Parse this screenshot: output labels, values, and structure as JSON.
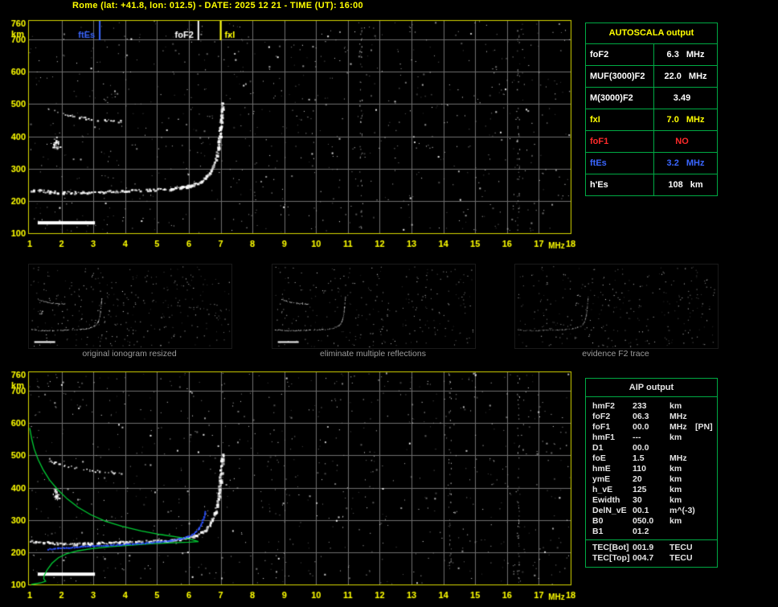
{
  "title": "Rome (lat: +41.8, lon: 012.5) - DATE: 2025 12 21 - TIME (UT): 16:00",
  "colors": {
    "accent_yellow": "#ffff00",
    "table_border_green": "#00aa44",
    "grid_gray": "#6f6f6f",
    "marker_blue": "#3a66ff",
    "status_red": "#ff2a2a",
    "caption_gray": "#9c9c9c",
    "profile_green": "#00cc33",
    "restored_blue": "#2b50ff"
  },
  "autoscala": {
    "header": "AUTOSCALA output",
    "rows": [
      {
        "label": "foF2",
        "value": "6.3",
        "unit": "MHz",
        "color": "#ffffff"
      },
      {
        "label": "MUF(3000)F2",
        "value": "22.0",
        "unit": "MHz",
        "color": "#ffffff"
      },
      {
        "label": "M(3000)F2",
        "value": "3.49",
        "unit": "",
        "color": "#ffffff"
      },
      {
        "label": "fxI",
        "value": "7.0",
        "unit": "MHz",
        "color": "#ffff00"
      },
      {
        "label": "foF1",
        "value": "NO",
        "unit": "",
        "color": "#ff2a2a"
      },
      {
        "label": "ftEs",
        "value": "3.2",
        "unit": "MHz",
        "color": "#3a66ff"
      },
      {
        "label": "h'Es",
        "value": "108",
        "unit": "km",
        "color": "#ffffff"
      }
    ]
  },
  "thumbnails": [
    {
      "caption": "original ionogram resized",
      "noise_dots": 330,
      "trace_indices": [
        0,
        1,
        2,
        3,
        4
      ],
      "brightness": 1
    },
    {
      "caption": "eliminate multiple reflections",
      "noise_dots": 270,
      "trace_indices": [
        0,
        1,
        2,
        4
      ],
      "brightness": 0.95
    },
    {
      "caption": "evidence F2 trace",
      "noise_dots": 300,
      "trace_indices": [
        0,
        1
      ],
      "brightness": 0.7
    }
  ],
  "aip": {
    "header": "AIP output",
    "rows": [
      {
        "label": "hmF2",
        "value": "233",
        "unit": "km",
        "note": ""
      },
      {
        "label": "foF2",
        "value": "06.3",
        "unit": "MHz",
        "note": ""
      },
      {
        "label": "foF1",
        "value": "00.0",
        "unit": "MHz",
        "note": "[PN]"
      },
      {
        "label": "hmF1",
        "value": "---",
        "unit": "km",
        "note": ""
      },
      {
        "label": "D1",
        "value": "00.0",
        "unit": "",
        "note": ""
      },
      {
        "label": "foE",
        "value": "1.5",
        "unit": "MHz",
        "note": ""
      },
      {
        "label": "hmE",
        "value": "110",
        "unit": "km",
        "note": ""
      },
      {
        "label": "ymE",
        "value": "20",
        "unit": "km",
        "note": ""
      },
      {
        "label": "h_vE",
        "value": "125",
        "unit": "km",
        "note": ""
      },
      {
        "label": "Ewidth",
        "value": "30",
        "unit": "km",
        "note": ""
      },
      {
        "label": "DelN_vE",
        "value": "00.1",
        "unit": "m^(-3)",
        "note": ""
      },
      {
        "label": "B0",
        "value": "050.0",
        "unit": "km",
        "note": ""
      },
      {
        "label": "B1",
        "value": "01.2",
        "unit": "",
        "note": ""
      }
    ],
    "tec_rows": [
      {
        "label": "TEC[Bot]",
        "value": "001.9",
        "unit": "TECU"
      },
      {
        "label": "TEC[Top]",
        "value": "004.7",
        "unit": "TECU"
      }
    ]
  },
  "chart_data": [
    {
      "type": "scatter",
      "name": "ionogram with autoscala frequency markers",
      "xlabel": "MHz",
      "ylabel": "km",
      "xlim": [
        0.95,
        18.05
      ],
      "ylim": [
        100,
        762
      ],
      "xticks": [
        1,
        2,
        3,
        4,
        5,
        6,
        7,
        8,
        9,
        10,
        11,
        12,
        13,
        14,
        15,
        16,
        17,
        18
      ],
      "yticks": [
        100,
        200,
        300,
        400,
        500,
        600,
        700,
        760
      ],
      "grid": true,
      "seed": 11,
      "noise": {
        "dots": 820
      },
      "rfi_columns": [
        11.4,
        16.35
      ],
      "frequency_markers": [
        {
          "label": "ftEs",
          "x": 3.2,
          "color": "#3a66ff",
          "label_side": "left"
        },
        {
          "label": "foF2",
          "x": 6.3,
          "color": "#ffffff",
          "label_side": "left"
        },
        {
          "label": "fxI",
          "x": 7.0,
          "color": "#ffff00",
          "label_side": "right"
        }
      ],
      "traces": [
        {
          "name": "sporadic-E trace ~230 km",
          "style": "dash",
          "size": 2.5,
          "gap": 0.18,
          "points": [
            [
              1.0,
              236
            ],
            [
              1.3,
              233
            ],
            [
              1.6,
              230
            ],
            [
              2.0,
              228
            ],
            [
              2.4,
              227
            ],
            [
              2.8,
              228
            ],
            [
              3.2,
              230
            ],
            [
              3.6,
              231
            ],
            [
              4.0,
              233
            ],
            [
              4.4,
              234
            ],
            [
              4.8,
              236
            ],
            [
              5.1,
              237
            ],
            [
              5.4,
              239
            ]
          ]
        },
        {
          "name": "F2 trace rising to foF2",
          "style": "dash",
          "size": 3,
          "gap": 0.1,
          "points": [
            [
              5.4,
              239
            ],
            [
              5.7,
              243
            ],
            [
              5.95,
              248
            ],
            [
              6.15,
              254
            ],
            [
              6.35,
              262
            ],
            [
              6.5,
              272
            ],
            [
              6.62,
              285
            ],
            [
              6.72,
              302
            ],
            [
              6.8,
              324
            ],
            [
              6.87,
              352
            ],
            [
              6.92,
              385
            ],
            [
              6.96,
              420
            ],
            [
              6.99,
              455
            ],
            [
              7.02,
              487
            ],
            [
              7.04,
              505
            ]
          ]
        },
        {
          "name": "second order echo ~450-490 km",
          "style": "dash",
          "size": 2,
          "gap": 0.45,
          "points": [
            [
              1.55,
              487
            ],
            [
              1.75,
              480
            ],
            [
              1.95,
              474
            ],
            [
              2.15,
              468
            ],
            [
              2.35,
              463
            ],
            [
              2.6,
              459
            ],
            [
              2.85,
              455
            ],
            [
              3.1,
              452
            ],
            [
              3.35,
              450
            ],
            [
              3.6,
              449
            ],
            [
              3.85,
              448
            ]
          ]
        },
        {
          "name": "echo patch ~380 km",
          "style": "cluster",
          "center": [
            1.82,
            380
          ],
          "spread": [
            0.12,
            22
          ],
          "count": 32
        },
        {
          "name": "interference bar ~130 km",
          "style": "bar",
          "x_range": [
            1.25,
            3.05
          ],
          "km_range": [
            127,
            137
          ]
        }
      ]
    },
    {
      "type": "scatter",
      "name": "ionogram with AIP restored trace and electron density profile",
      "xlabel": "MHz",
      "ylabel": "km",
      "xlim": [
        0.95,
        18.05
      ],
      "ylim": [
        100,
        762
      ],
      "xticks": [
        1,
        2,
        3,
        4,
        5,
        6,
        7,
        8,
        9,
        10,
        11,
        12,
        13,
        14,
        15,
        16,
        17,
        18
      ],
      "yticks": [
        100,
        200,
        300,
        400,
        500,
        600,
        700,
        760
      ],
      "grid": true,
      "seed": 23,
      "noise": {
        "dots": 820
      },
      "rfi_columns": [
        14.2,
        16.35
      ],
      "traces": [
        {
          "name": "sporadic-E trace ~230 km",
          "style": "dash",
          "size": 2.5,
          "gap": 0.18,
          "points": [
            [
              1.0,
              236
            ],
            [
              1.3,
              233
            ],
            [
              1.6,
              230
            ],
            [
              2.0,
              228
            ],
            [
              2.4,
              227
            ],
            [
              2.8,
              228
            ],
            [
              3.2,
              230
            ],
            [
              3.6,
              231
            ],
            [
              4.0,
              233
            ],
            [
              4.4,
              234
            ],
            [
              4.8,
              236
            ],
            [
              5.1,
              237
            ],
            [
              5.4,
              239
            ]
          ]
        },
        {
          "name": "F2 trace rising to foF2",
          "style": "dash",
          "size": 3,
          "gap": 0.1,
          "points": [
            [
              5.4,
              239
            ],
            [
              5.7,
              243
            ],
            [
              5.95,
              248
            ],
            [
              6.15,
              254
            ],
            [
              6.35,
              262
            ],
            [
              6.5,
              272
            ],
            [
              6.62,
              285
            ],
            [
              6.72,
              302
            ],
            [
              6.8,
              324
            ],
            [
              6.87,
              352
            ],
            [
              6.92,
              385
            ],
            [
              6.96,
              420
            ],
            [
              6.99,
              455
            ],
            [
              7.02,
              487
            ],
            [
              7.04,
              505
            ]
          ]
        },
        {
          "name": "second order echo ~450-490 km",
          "style": "dash",
          "size": 2,
          "gap": 0.45,
          "points": [
            [
              1.55,
              487
            ],
            [
              1.75,
              480
            ],
            [
              1.95,
              474
            ],
            [
              2.15,
              468
            ],
            [
              2.35,
              463
            ],
            [
              2.6,
              459
            ],
            [
              2.85,
              455
            ],
            [
              3.1,
              452
            ],
            [
              3.35,
              450
            ],
            [
              3.6,
              449
            ],
            [
              3.85,
              448
            ]
          ]
        },
        {
          "name": "echo patch ~380 km",
          "style": "cluster",
          "center": [
            1.82,
            380
          ],
          "spread": [
            0.12,
            22
          ],
          "count": 32
        },
        {
          "name": "interference bar ~130 km",
          "style": "bar",
          "x_range": [
            1.25,
            3.05
          ],
          "km_range": [
            127,
            137
          ]
        },
        {
          "name": "electron density profile topside (hmF2 233 km, foF2 6.3 MHz)",
          "style": "line",
          "color": "#00cc33",
          "width": 1.3,
          "points": [
            [
              1.0,
              585
            ],
            [
              1.06,
              552
            ],
            [
              1.14,
              520
            ],
            [
              1.26,
              488
            ],
            [
              1.42,
              456
            ],
            [
              1.62,
              424
            ],
            [
              1.88,
              394
            ],
            [
              2.18,
              365
            ],
            [
              2.52,
              339
            ],
            [
              2.92,
              316
            ],
            [
              3.38,
              296
            ],
            [
              3.9,
              280
            ],
            [
              4.5,
              266
            ],
            [
              5.1,
              255
            ],
            [
              5.7,
              246
            ],
            [
              6.1,
              239
            ],
            [
              6.3,
              233
            ]
          ]
        },
        {
          "name": "electron density profile bottomside (foE 1.5 MHz at 110 km)",
          "style": "line",
          "color": "#00cc33",
          "width": 1.3,
          "points": [
            [
              1.05,
              100
            ],
            [
              1.35,
              105
            ],
            [
              1.5,
              110
            ],
            [
              1.44,
              118
            ],
            [
              1.45,
              127
            ],
            [
              1.55,
              146
            ],
            [
              1.7,
              166
            ],
            [
              1.9,
              183
            ],
            [
              2.15,
              195
            ],
            [
              2.5,
              204
            ],
            [
              2.95,
              211
            ],
            [
              3.5,
              217
            ],
            [
              4.1,
              221
            ],
            [
              4.8,
              226
            ],
            [
              5.5,
              229
            ],
            [
              6.0,
              231
            ],
            [
              6.3,
              233
            ]
          ]
        },
        {
          "name": "restored F2 trace (fit)",
          "style": "dotline",
          "color": "#2b50ff",
          "size": 2,
          "points": [
            [
              1.55,
              211
            ],
            [
              1.85,
              214
            ],
            [
              2.2,
              216
            ],
            [
              2.6,
              219
            ],
            [
              3.0,
              221
            ],
            [
              3.4,
              223
            ],
            [
              3.8,
              225
            ],
            [
              4.2,
              228
            ],
            [
              4.6,
              230
            ],
            [
              5.0,
              233
            ],
            [
              5.4,
              238
            ],
            [
              5.7,
              243
            ],
            [
              5.95,
              250
            ],
            [
              6.15,
              260
            ],
            [
              6.3,
              275
            ],
            [
              6.4,
              295
            ],
            [
              6.46,
              312
            ],
            [
              6.5,
              328
            ]
          ]
        }
      ]
    }
  ]
}
